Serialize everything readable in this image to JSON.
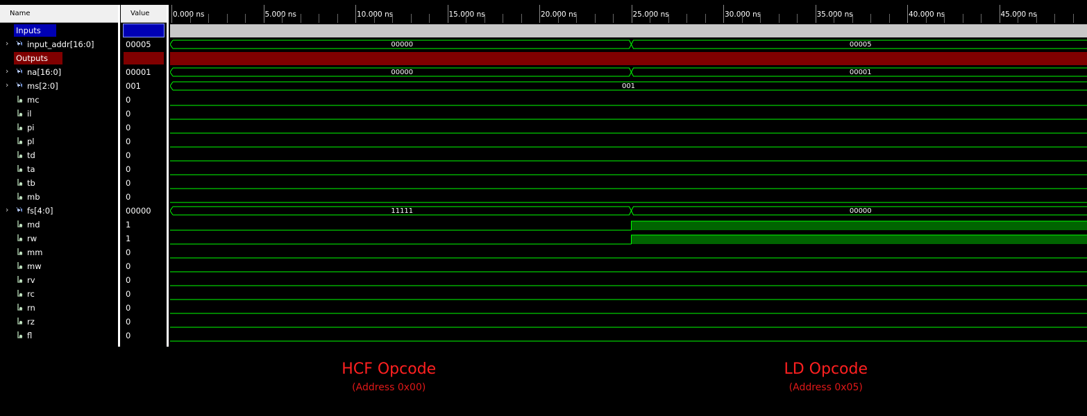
{
  "columns": {
    "name": "Name",
    "value": "Value"
  },
  "timeline": {
    "ticks": [
      "0.000 ns",
      "5.000 ns",
      "10.000 ns",
      "15.000 ns",
      "20.000 ns",
      "25.000 ns",
      "30.000 ns",
      "35.000 ns",
      "40.000 ns",
      "45.000 ns"
    ],
    "tick_step_ns": 5,
    "transition_ns": 25
  },
  "colors": {
    "inputs_group": "#0000b4",
    "outputs_group": "#800000",
    "wave": "#00ff00",
    "high_fill": "#006400",
    "annotation": "#ff2020"
  },
  "signals": [
    {
      "name": "Inputs",
      "type": "group",
      "value": ""
    },
    {
      "name": "input_addr[16:0]",
      "type": "bus",
      "value": "00005",
      "segments": [
        "00000",
        "00005"
      ]
    },
    {
      "name": "Outputs",
      "type": "group",
      "value": ""
    },
    {
      "name": "na[16:0]",
      "type": "bus",
      "value": "00001",
      "segments": [
        "00000",
        "00001"
      ]
    },
    {
      "name": "ms[2:0]",
      "type": "bus",
      "value": "001",
      "segments": [
        "001"
      ]
    },
    {
      "name": "mc",
      "type": "bit",
      "value": "0",
      "levels": [
        0
      ]
    },
    {
      "name": "il",
      "type": "bit",
      "value": "0",
      "levels": [
        0
      ]
    },
    {
      "name": "pi",
      "type": "bit",
      "value": "0",
      "levels": [
        0
      ]
    },
    {
      "name": "pl",
      "type": "bit",
      "value": "0",
      "levels": [
        0
      ]
    },
    {
      "name": "td",
      "type": "bit",
      "value": "0",
      "levels": [
        0
      ]
    },
    {
      "name": "ta",
      "type": "bit",
      "value": "0",
      "levels": [
        0
      ]
    },
    {
      "name": "tb",
      "type": "bit",
      "value": "0",
      "levels": [
        0
      ]
    },
    {
      "name": "mb",
      "type": "bit",
      "value": "0",
      "levels": [
        0
      ]
    },
    {
      "name": "fs[4:0]",
      "type": "bus",
      "value": "00000",
      "segments": [
        "11111",
        "00000"
      ]
    },
    {
      "name": "md",
      "type": "bit",
      "value": "1",
      "levels": [
        0,
        1
      ]
    },
    {
      "name": "rw",
      "type": "bit",
      "value": "1",
      "levels": [
        0,
        1
      ]
    },
    {
      "name": "mm",
      "type": "bit",
      "value": "0",
      "levels": [
        0
      ]
    },
    {
      "name": "mw",
      "type": "bit",
      "value": "0",
      "levels": [
        0
      ]
    },
    {
      "name": "rv",
      "type": "bit",
      "value": "0",
      "levels": [
        0
      ]
    },
    {
      "name": "rc",
      "type": "bit",
      "value": "0",
      "levels": [
        0
      ]
    },
    {
      "name": "rn",
      "type": "bit",
      "value": "0",
      "levels": [
        0
      ]
    },
    {
      "name": "rz",
      "type": "bit",
      "value": "0",
      "levels": [
        0
      ]
    },
    {
      "name": "fl",
      "type": "bit",
      "value": "0",
      "levels": [
        0
      ]
    }
  ],
  "annotations": [
    {
      "title": "HCF Opcode",
      "subtitle": "(Address 0x00)"
    },
    {
      "title": "LD Opcode",
      "subtitle": "(Address 0x05)"
    }
  ]
}
